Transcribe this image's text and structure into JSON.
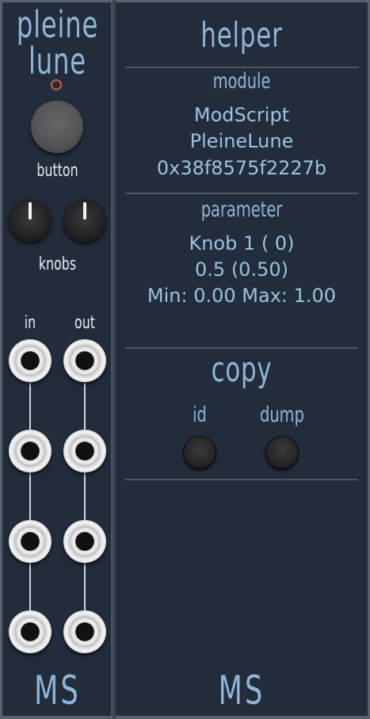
{
  "left_panel": {
    "title_line1": "pleine",
    "title_line2": "lune",
    "button_label": "button",
    "knobs_label": "knobs",
    "in_label": "in",
    "out_label": "out",
    "footer_logo": "MS"
  },
  "right_panel": {
    "title": "helper",
    "module_heading": "module",
    "module_name": "ModScript",
    "module_model": "PleineLune",
    "module_id": "0x38f8575f2227b",
    "parameter_heading": "parameter",
    "param_name": "Knob 1 ( 0)",
    "param_value": "0.5 (0.50)",
    "param_range": "Min: 0.00 Max: 1.00",
    "copy_heading": "copy",
    "copy_id_label": "id",
    "copy_dump_label": "dump",
    "footer_logo": "MS"
  },
  "knobs": [
    {
      "name": "knob-1",
      "value": 0.5
    },
    {
      "name": "knob-2",
      "value": 0.5
    }
  ],
  "colors": {
    "panel": "#222c3b",
    "title": "#8fb6d6",
    "info_text": "#9cc3e0",
    "label_text": "#e6eef5",
    "led": "#d05a3a"
  }
}
